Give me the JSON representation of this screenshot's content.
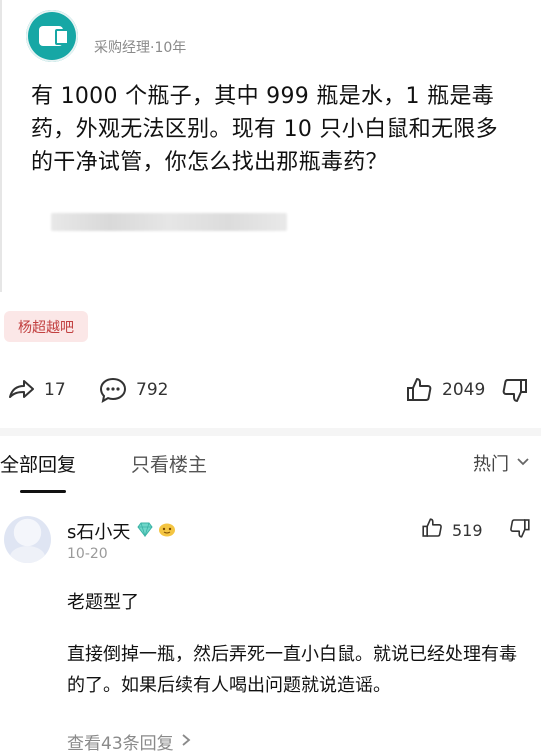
{
  "post": {
    "author_meta": "采购经理·10年",
    "question": "有 1000 个瓶子，其中 999 瓶是水，1 瓶是毒药，外观无法区别。现有 10 只小白鼠和无限多的干净试管，你怎么找出那瓶毒药？",
    "tag": "杨超越吧"
  },
  "actions": {
    "share_count": "17",
    "comment_count": "792",
    "like_count": "2049",
    "icons": [
      "share-icon",
      "comment-icon",
      "thumbs-up-icon",
      "thumbs-down-icon"
    ]
  },
  "tabs": {
    "all_replies": "全部回复",
    "op_only": "只看楼主",
    "sort_label": "热门"
  },
  "comment": {
    "username": "s石小天",
    "date": "10-20",
    "like_count": "519",
    "text1": "老题型了",
    "text2": "直接倒掉一瓶，然后弄死一直小白鼠。就说已经处理有毒的了。如果后续有人喝出问题就说造谣。",
    "view_more": "查看43条回复"
  },
  "colors": {
    "avatar_teal": "#16a7a5",
    "tag_bg": "#fbe7e7",
    "tag_text": "#c24141",
    "gem_badge": "#5bcfc2"
  }
}
